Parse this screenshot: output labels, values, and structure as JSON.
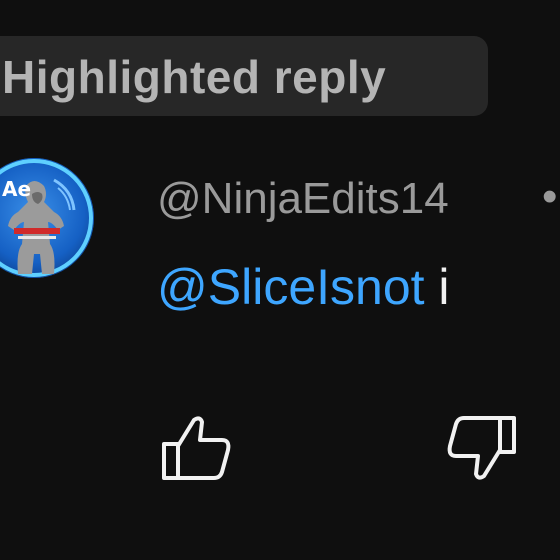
{
  "banner": {
    "label": "Highlighted reply"
  },
  "comment": {
    "author": "@NinjaEdits14",
    "separator": "•",
    "mention": "@SliceIsnot",
    "text_fragment": " i",
    "avatar_icon": "user-avatar"
  },
  "actions": {
    "like_icon": "thumbs-up-icon",
    "dislike_icon": "thumbs-down-icon"
  },
  "colors": {
    "background": "#0f0f0f",
    "chip": "#272727",
    "mention": "#3ea6ff",
    "muted_text": "#9a9a9a"
  }
}
